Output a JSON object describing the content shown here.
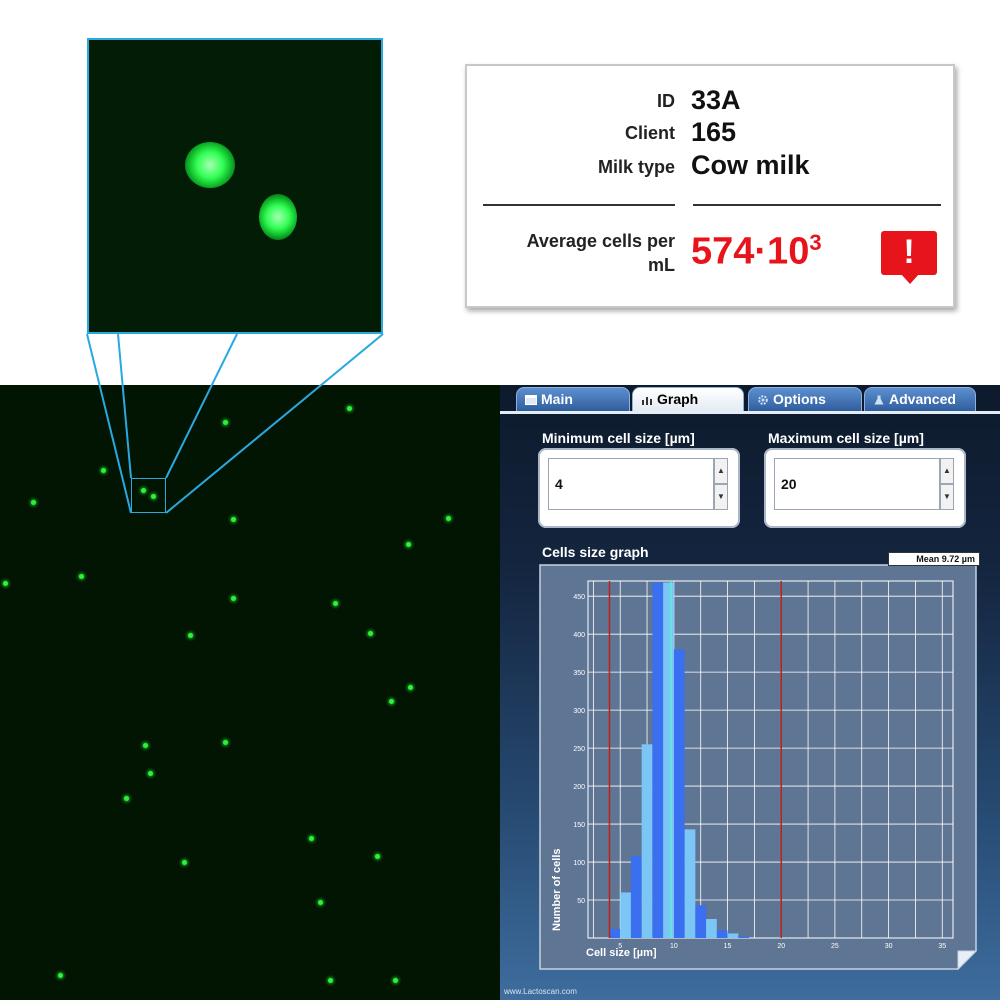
{
  "info_card": {
    "id_label": "ID",
    "id_value": "33A",
    "client_label": "Client",
    "client_value": "165",
    "milk_label": "Milk type",
    "milk_value": "Cow milk",
    "avg_label_line1": "Average cells per",
    "avg_label_line2": "mL",
    "avg_value_base": "574·10",
    "avg_value_exp": "3",
    "alert_icon": "exclamation-alert-icon",
    "alert_glyph": "!",
    "alert_color": "#e8141c"
  },
  "tabs": [
    {
      "label": "Main",
      "icon": "window-icon",
      "active": false
    },
    {
      "label": "Graph",
      "icon": "bar-chart-icon",
      "active": true
    },
    {
      "label": "Options",
      "icon": "gear-icon",
      "active": false
    },
    {
      "label": "Advanced",
      "icon": "flask-icon",
      "active": false
    }
  ],
  "min_size": {
    "label": "Minimum cell size [µm]",
    "value": "4"
  },
  "max_size": {
    "label": "Maximum cell size [µm]",
    "value": "20"
  },
  "graph": {
    "title": "Cells size graph",
    "mean_label": "Mean 9.72 µm"
  },
  "footer": "www.Lactoscan.com",
  "chart_data": {
    "type": "bar",
    "xlabel": "Cell size [µm]",
    "ylabel": "Number of cells",
    "xlim": [
      2,
      36
    ],
    "ylim": [
      0,
      470
    ],
    "xticks": [
      5,
      10,
      15,
      20,
      25,
      30,
      35
    ],
    "yticks": [
      50,
      100,
      150,
      200,
      250,
      300,
      350,
      400,
      450
    ],
    "grid": true,
    "bin_width": 1,
    "bins": [
      {
        "x": 4,
        "value": 12
      },
      {
        "x": 5,
        "value": 60
      },
      {
        "x": 6,
        "value": 108
      },
      {
        "x": 7,
        "value": 255
      },
      {
        "x": 8,
        "value": 468
      },
      {
        "x": 9,
        "value": 468
      },
      {
        "x": 10,
        "value": 380
      },
      {
        "x": 11,
        "value": 143
      },
      {
        "x": 12,
        "value": 43
      },
      {
        "x": 13,
        "value": 25
      },
      {
        "x": 14,
        "value": 10
      },
      {
        "x": 15,
        "value": 6
      },
      {
        "x": 16,
        "value": 2
      }
    ],
    "bar_colors": [
      "#3a6ff0",
      "#7cc6f5"
    ],
    "limit_lines": [
      {
        "x": 4,
        "color": "#c0201a"
      },
      {
        "x": 20,
        "color": "#c0201a"
      }
    ],
    "mean_line": {
      "x": 9.72,
      "color": "#5ef0d8"
    }
  }
}
